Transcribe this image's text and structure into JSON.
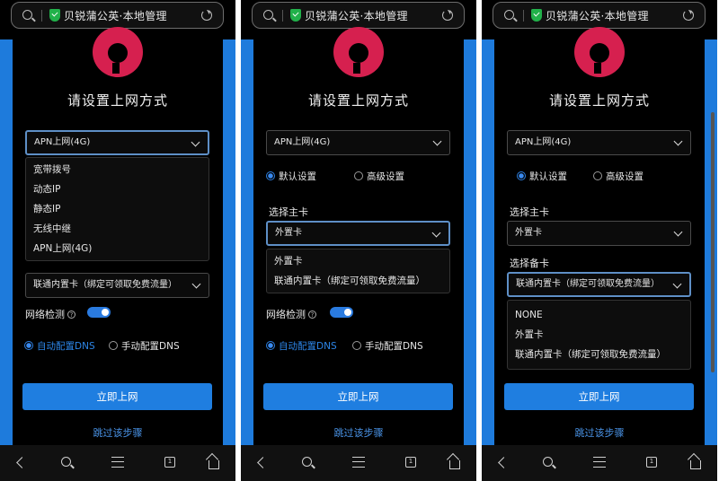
{
  "url_bar": {
    "title": "贝锐蒲公英·本地管理"
  },
  "heading": "请设置上网方式",
  "network_mode": {
    "selected": "APN上网(4G)",
    "options": [
      "宽带拨号",
      "动态IP",
      "静态IP",
      "无线中继",
      "APN上网(4G)"
    ]
  },
  "settings_radio": {
    "default": "默认设置",
    "advanced": "高级设置"
  },
  "primary_card": {
    "label": "选择主卡",
    "selected": "外置卡",
    "options": [
      "外置卡",
      "联通内置卡（绑定可领取免费流量）"
    ]
  },
  "backup_card": {
    "label": "选择备卡",
    "selected": "联通内置卡（绑定可领取免费流量）",
    "options": [
      "NONE",
      "外置卡",
      "联通内置卡（绑定可领取免费流量）"
    ]
  },
  "network_check": {
    "label": "网络检测",
    "help": "?",
    "enabled": true
  },
  "dns_radio": {
    "auto": "自动配置DNS",
    "manual": "手动配置DNS"
  },
  "connect_button": "立即上网",
  "skip_link": "跳过该步骤",
  "nav": {
    "tabs_count": "1"
  },
  "colors": {
    "accent": "#1f7ee0",
    "logo": "#d6204f",
    "shield": "#21b14a"
  }
}
